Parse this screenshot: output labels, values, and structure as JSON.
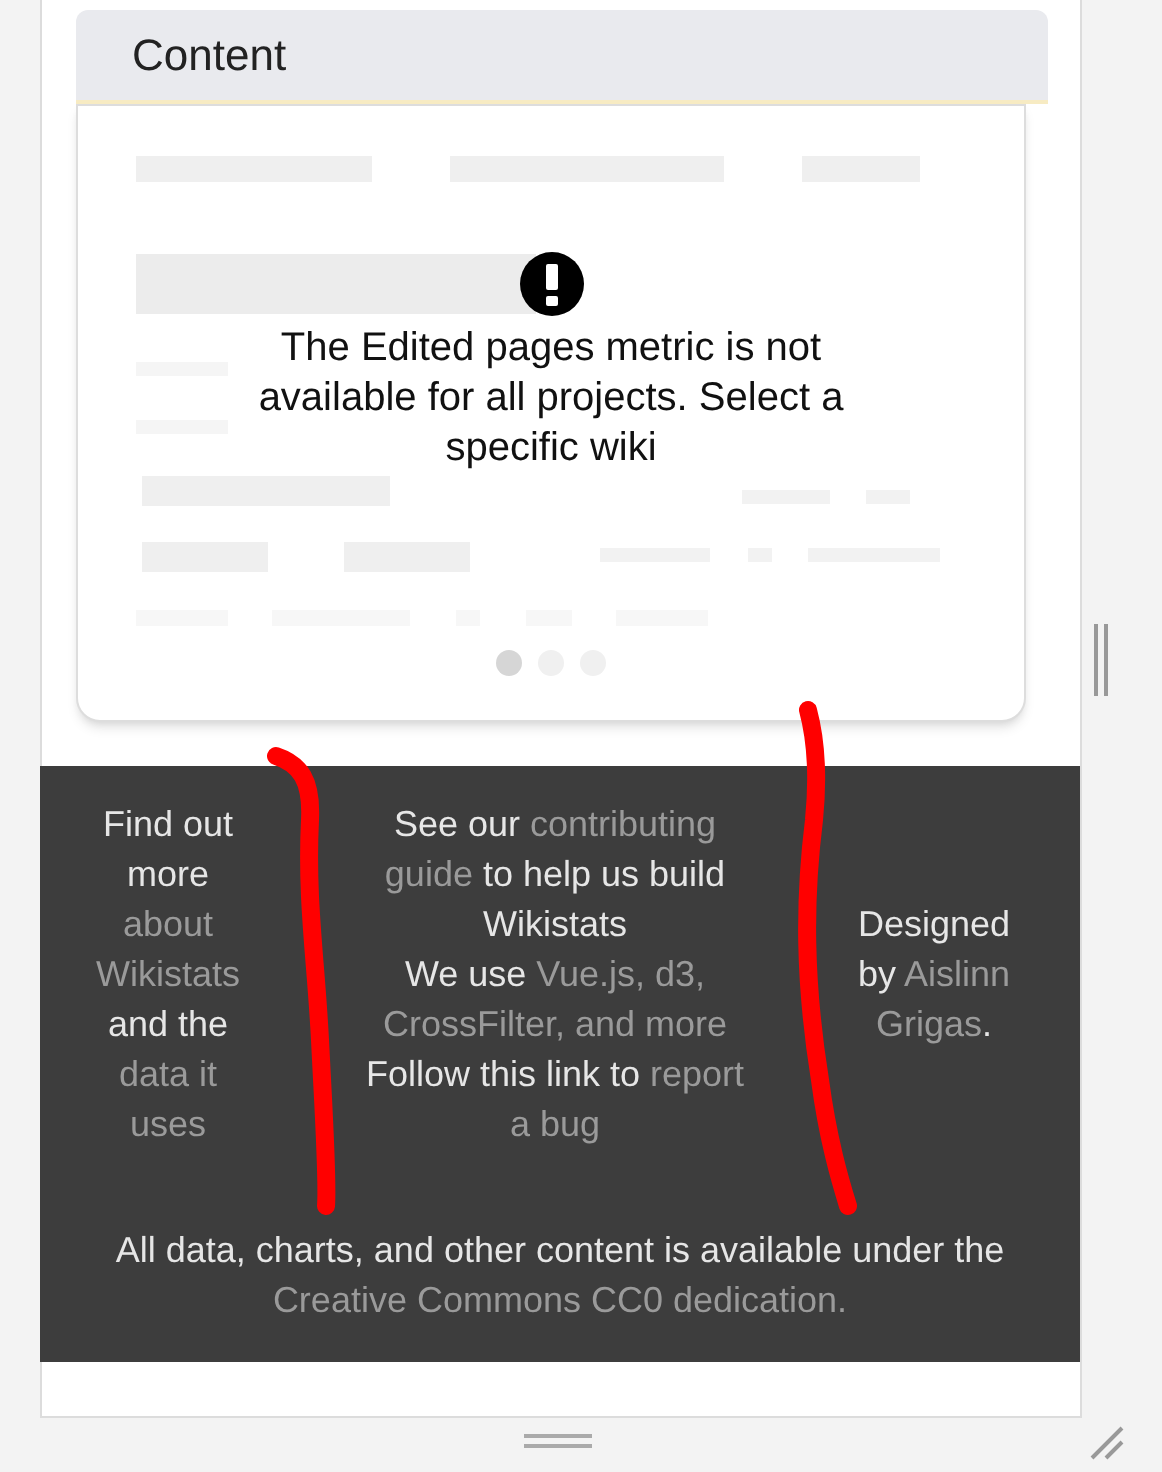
{
  "panel": {
    "title": "Content"
  },
  "card": {
    "message": "The Edited pages metric is not available for all projects. Select a specific wiki",
    "pager": [
      {
        "selected": true
      },
      {
        "selected": false
      },
      {
        "selected": false
      }
    ]
  },
  "footer": {
    "columns": [
      [
        [
          {
            "text": "Find out",
            "link": false
          }
        ],
        [
          {
            "text": "more",
            "link": false
          }
        ],
        [
          {
            "text": "about",
            "link": true
          }
        ],
        [
          {
            "text": "Wikistats",
            "link": true
          }
        ],
        [
          {
            "text": "and the",
            "link": false
          }
        ],
        [
          {
            "text": "data it",
            "link": true
          }
        ],
        [
          {
            "text": "uses",
            "link": true
          }
        ]
      ],
      [
        [
          {
            "text": "See our ",
            "link": false
          },
          {
            "text": "contributing",
            "link": true
          }
        ],
        [
          {
            "text": "guide",
            "link": true
          },
          {
            "text": " to help us build",
            "link": false
          }
        ],
        [
          {
            "text": "Wikistats",
            "link": false
          }
        ],
        [
          {
            "text": "We use ",
            "link": false
          },
          {
            "text": "Vue.js, d3,",
            "link": true
          }
        ],
        [
          {
            "text": "CrossFilter, and more",
            "link": true
          }
        ],
        [
          {
            "text": "Follow this link to ",
            "link": false
          },
          {
            "text": "report",
            "link": true
          }
        ],
        [
          {
            "text": "a bug",
            "link": true
          }
        ]
      ],
      [
        [
          {
            "text": "Designed",
            "link": false
          }
        ],
        [
          {
            "text": "by ",
            "link": false
          },
          {
            "text": "Aislinn",
            "link": true
          }
        ],
        [
          {
            "text": "Grigas",
            "link": true
          },
          {
            "text": ".",
            "link": false
          }
        ]
      ]
    ],
    "license": [
      [
        {
          "text": "All data, charts, and other content is available under the",
          "link": false
        }
      ],
      [
        {
          "text": "Creative Commons CC0 dedication.",
          "link": true
        }
      ]
    ]
  }
}
